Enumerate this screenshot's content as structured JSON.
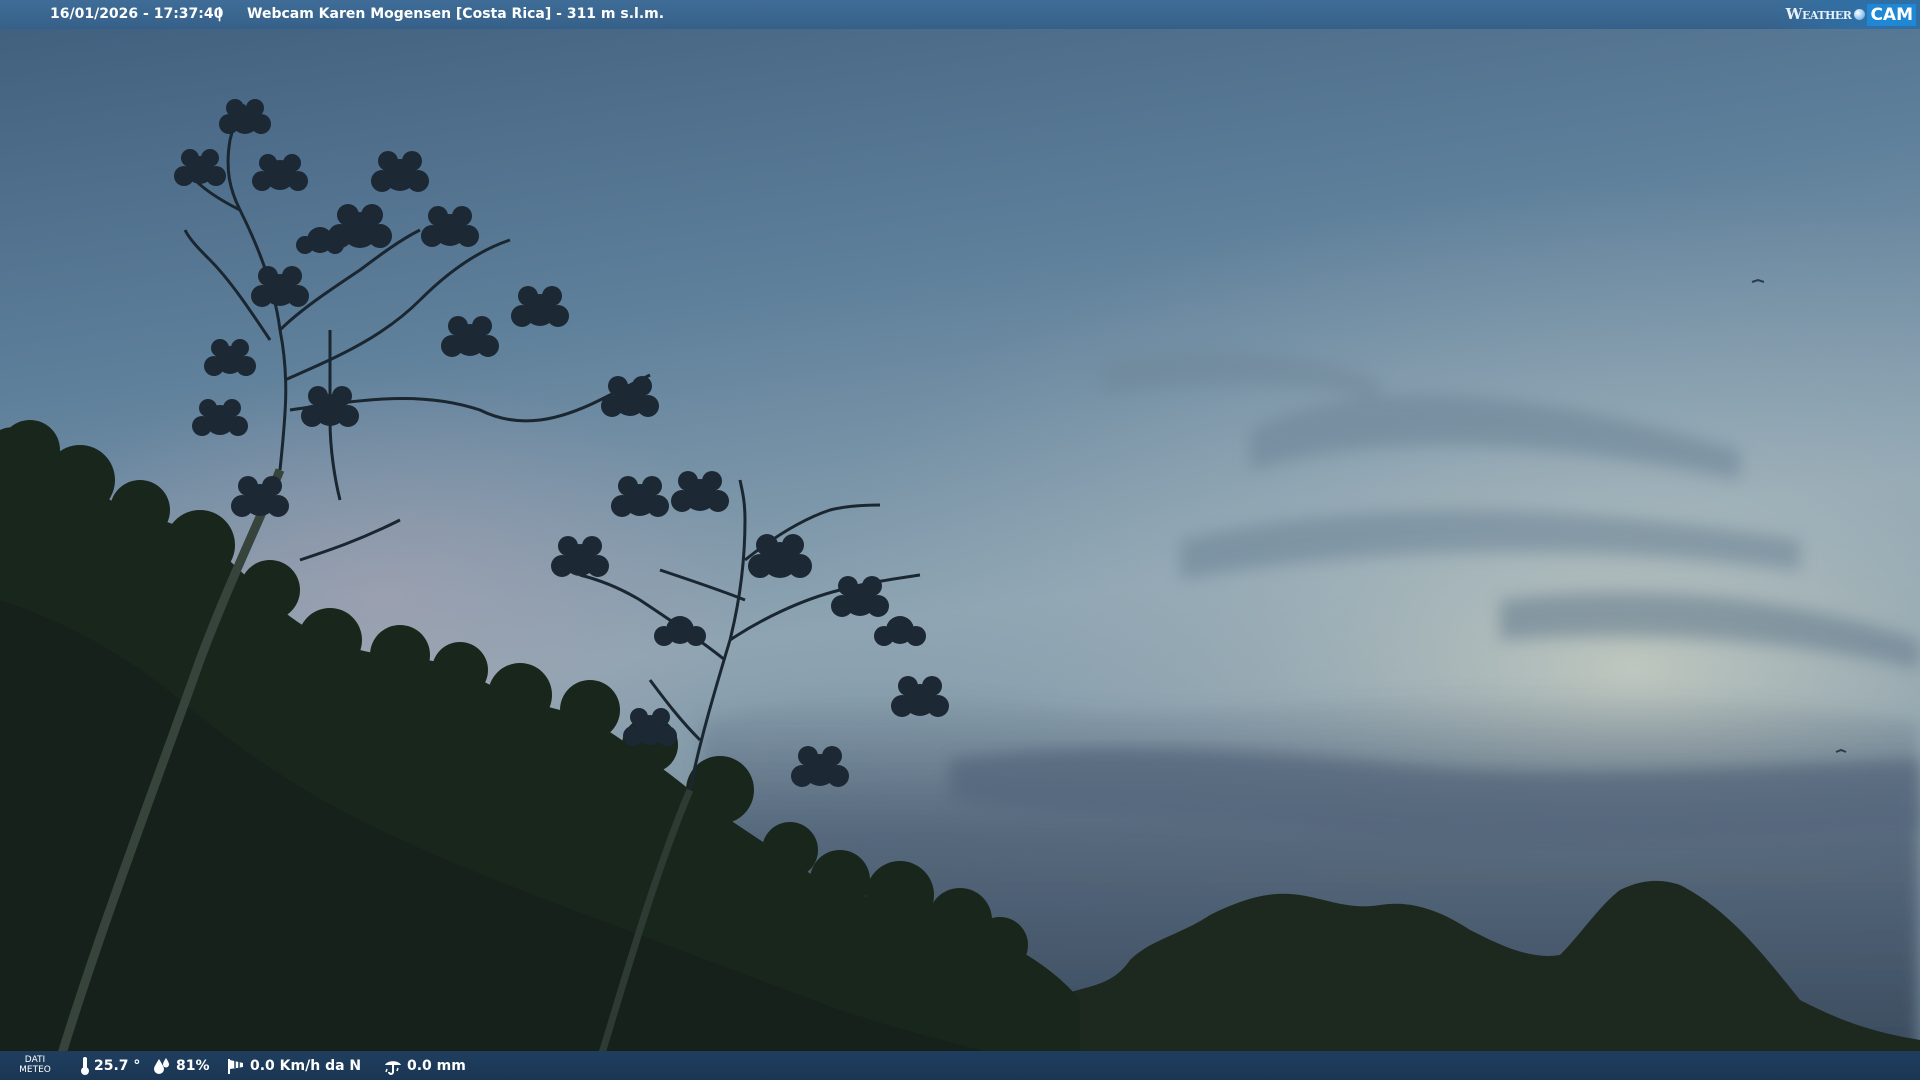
{
  "header": {
    "datetime": "16/01/2026 - 17:37:40",
    "separator": "|",
    "title": "Webcam Karen Mogensen [Costa Rica] - 311 m s.l.m.",
    "logo_weather": "Weather",
    "logo_cam": "CAM"
  },
  "weather": {
    "label_line1": "DATI",
    "label_line2": "METEO",
    "temperature": "25.7 °",
    "humidity": "81%",
    "wind": "0.0 Km/h da N",
    "rain": "0.0 mm"
  },
  "icons": {
    "temperature": "thermometer-icon",
    "humidity": "humidity-drops-icon",
    "wind": "windsock-icon",
    "rain": "rain-gauge-icon"
  },
  "colors": {
    "top_bar": "#3a6690",
    "bottom_bar": "#1d3a59",
    "logo_cam_bg": "#1f87d4",
    "sky_top": "#4f7391",
    "sky_horizon": "#a6b9c2",
    "foliage": "#182419"
  }
}
